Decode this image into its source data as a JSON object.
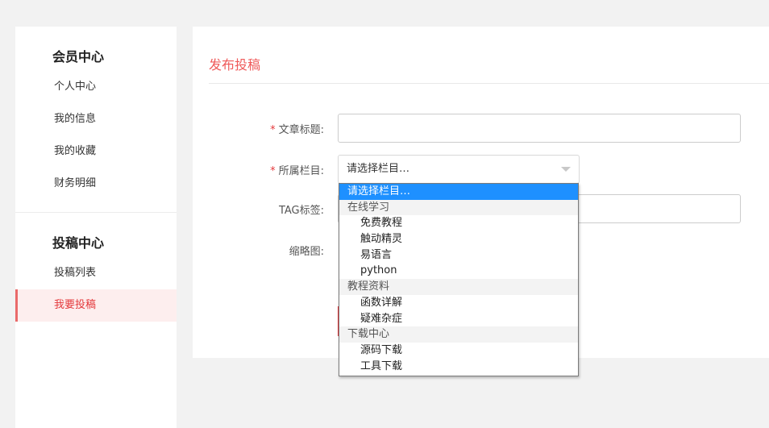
{
  "sidebar": {
    "member_title": "会员中心",
    "member_items": [
      "个人中心",
      "我的信息",
      "我的收藏",
      "财务明细"
    ],
    "submit_title": "投稿中心",
    "submit_items": [
      "投稿列表",
      "我要投稿"
    ]
  },
  "main": {
    "title": "发布投稿",
    "form": {
      "required_mark": "*",
      "title_label": "文章标题:",
      "title_value": "",
      "category_label": "所属栏目:",
      "category_value": "请选择栏目…",
      "tag_label": "TAG标签:",
      "tag_value": "",
      "thumb_label": "缩略图:"
    }
  },
  "dropdown": {
    "options": [
      {
        "label": "请选择栏目…",
        "type": "option",
        "selected": true
      },
      {
        "label": "在线学习",
        "type": "group"
      },
      {
        "label": "免费教程",
        "type": "child"
      },
      {
        "label": "触动精灵",
        "type": "child"
      },
      {
        "label": "易语言",
        "type": "child"
      },
      {
        "label": "python",
        "type": "child"
      },
      {
        "label": "教程资料",
        "type": "group"
      },
      {
        "label": "函数详解",
        "type": "child"
      },
      {
        "label": "疑难杂症",
        "type": "child"
      },
      {
        "label": "下载中心",
        "type": "group"
      },
      {
        "label": "源码下载",
        "type": "child"
      },
      {
        "label": "工具下载",
        "type": "child"
      }
    ]
  },
  "colors": {
    "accent": "#ef5a5a",
    "active_bg": "#fdeeee",
    "selected_option": "#1e90ff"
  }
}
